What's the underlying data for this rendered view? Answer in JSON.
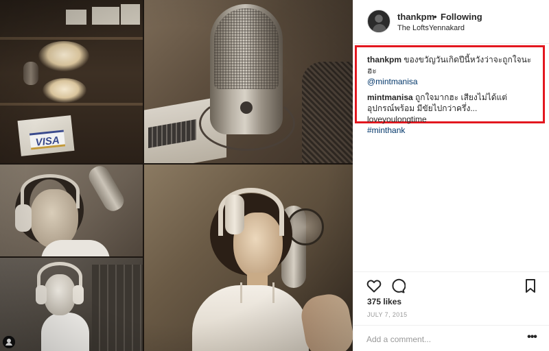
{
  "post": {
    "username": "thankpm",
    "separator": "•",
    "follow_status": "Following",
    "location": "The LoftsYennakard"
  },
  "comments": [
    {
      "user": "thankpm",
      "text": "ของขวัญวันเกิดปีนี้หวังว่าจะถูกใจนะฮะ",
      "mention": "@mintmanisa"
    },
    {
      "user": "mintmanisa",
      "text": "ถูกใจมากฮะ เสียงไม่ได้แต่อุปกรณ์พร้อม มีขัยไปกว่าครึ่ง... loveyoulongtime",
      "hashtag": "#minthank"
    }
  ],
  "stats": {
    "likes": "375 likes",
    "date": "JULY 7, 2015"
  },
  "comment_box": {
    "placeholder": "Add a comment...",
    "more_label": "•••"
  },
  "photo": {
    "card_text": "VISA",
    "user_badge_icon": "user-icon"
  },
  "colors": {
    "highlight_border": "#e3171f",
    "mention": "#003569",
    "muted": "#999999"
  }
}
